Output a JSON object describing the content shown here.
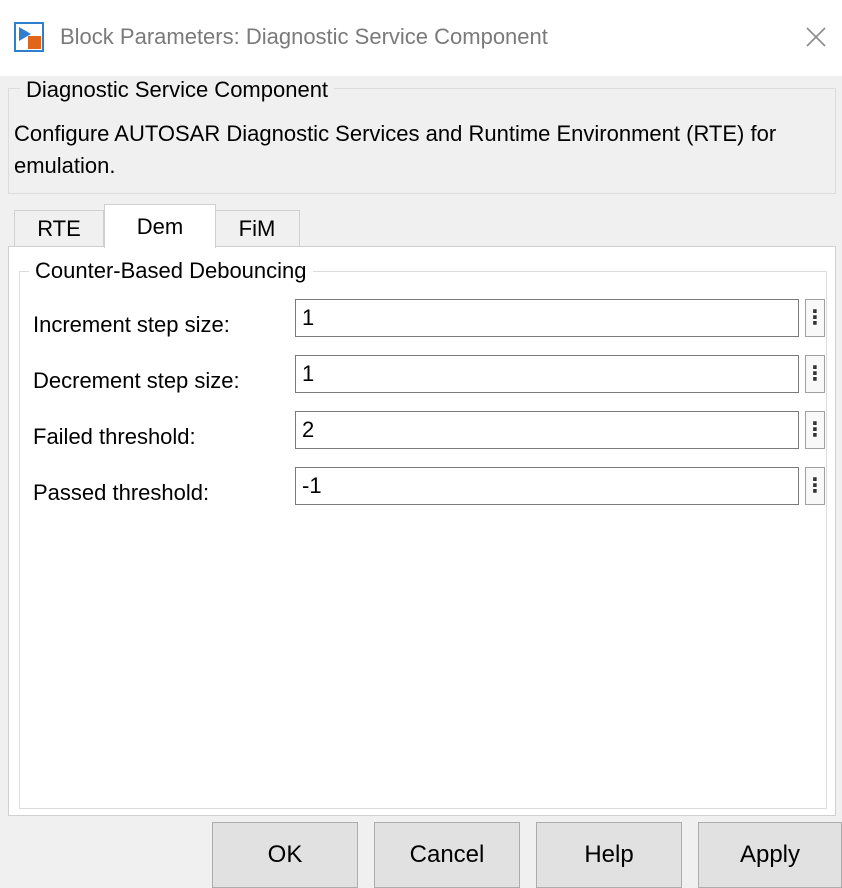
{
  "window": {
    "title": "Block Parameters: Diagnostic Service Component",
    "app_icon": "simulink-block-icon",
    "close_icon": "close-icon"
  },
  "header": {
    "group_title": "Diagnostic Service Component",
    "description": "Configure AUTOSAR Diagnostic Services and Runtime Environment (RTE) for emulation."
  },
  "tabs": [
    {
      "label": "RTE",
      "active": false
    },
    {
      "label": "Dem",
      "active": true
    },
    {
      "label": "FiM",
      "active": false
    }
  ],
  "dem": {
    "group_title": "Counter-Based Debouncing",
    "fields": [
      {
        "label": "Increment step size:",
        "value": "1"
      },
      {
        "label": "Decrement step size:",
        "value": "1"
      },
      {
        "label": "Failed threshold:",
        "value": "2"
      },
      {
        "label": "Passed threshold:",
        "value": "-1"
      }
    ],
    "menu_glyph": "⋮"
  },
  "buttons": {
    "ok": "OK",
    "cancel": "Cancel",
    "help": "Help",
    "apply": "Apply"
  },
  "colors": {
    "dialog_bg": "#f0f0f0",
    "title_text": "#7a7a7a",
    "icon_blue": "#2f7fd0",
    "icon_orange": "#e0661a"
  }
}
